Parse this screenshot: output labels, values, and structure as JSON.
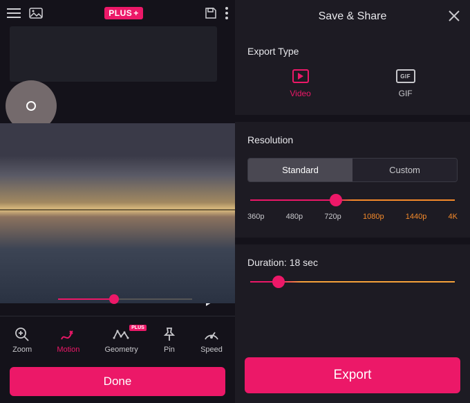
{
  "topbar": {
    "plus_label": "PLUS"
  },
  "tools": {
    "zoom": "Zoom",
    "motion": "Motion",
    "geometry": "Geometry",
    "geometry_badge": "PLUS",
    "pin": "Pin",
    "speed": "Speed"
  },
  "done_label": "Done",
  "right": {
    "title": "Save & Share",
    "export_type_label": "Export Type",
    "video_label": "Video",
    "gif_label": "GIF",
    "gif_icon_text": "GIF",
    "resolution_label": "Resolution",
    "seg_standard": "Standard",
    "seg_custom": "Custom",
    "res": {
      "r360": "360p",
      "r480": "480p",
      "r720": "720p",
      "r1080": "1080p",
      "r1440": "1440p",
      "r4k": "4K"
    },
    "duration_label": "Duration: 18 sec",
    "export_btn": "Export"
  }
}
